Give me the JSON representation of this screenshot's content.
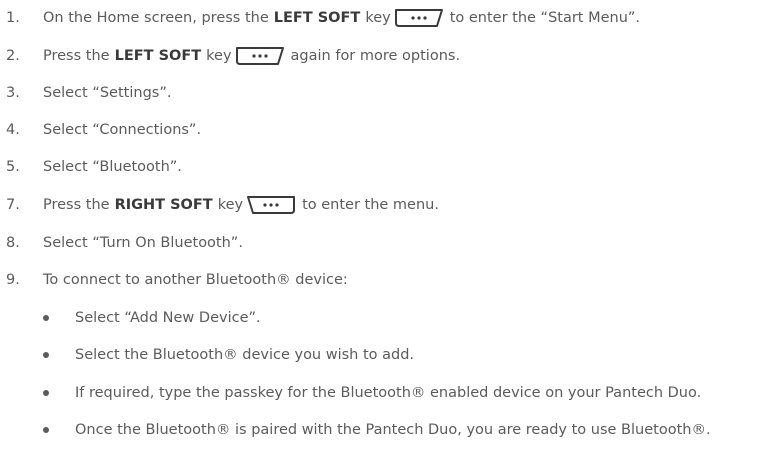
{
  "steps": [
    {
      "num": "1.",
      "pre": "On the Home screen, press the",
      "bold": "LEFT SOFT",
      "mid": "key",
      "icon": "left-soft-key-icon",
      "post": "to enter the “Start Menu”."
    },
    {
      "num": "2.",
      "pre": "Press the",
      "bold": "LEFT SOFT",
      "mid": "key",
      "icon": "left-soft-key-icon",
      "post": "again for more options."
    },
    {
      "num": "3.",
      "text": "Select “Settings”."
    },
    {
      "num": "4.",
      "text": "Select “Connections”."
    },
    {
      "num": "5.",
      "text": "Select “Bluetooth”."
    },
    {
      "num": "7.",
      "pre": "Press the",
      "bold": "RIGHT SOFT",
      "mid": "key",
      "icon": "right-soft-key-icon",
      "post": "to enter the menu."
    },
    {
      "num": "8.",
      "text": "Select “Turn On Bluetooth”."
    },
    {
      "num": "9.",
      "text": "To connect to another Bluetooth® device:"
    }
  ],
  "bullets": [
    "Select “Add New Device”.",
    "Select the Bluetooth® device you wish to add.",
    "If required, type the passkey for the Bluetooth® enabled device on your Pantech Duo.",
    "Once the Bluetooth® is paired with the Pantech Duo, you are ready to use Bluetooth®."
  ]
}
